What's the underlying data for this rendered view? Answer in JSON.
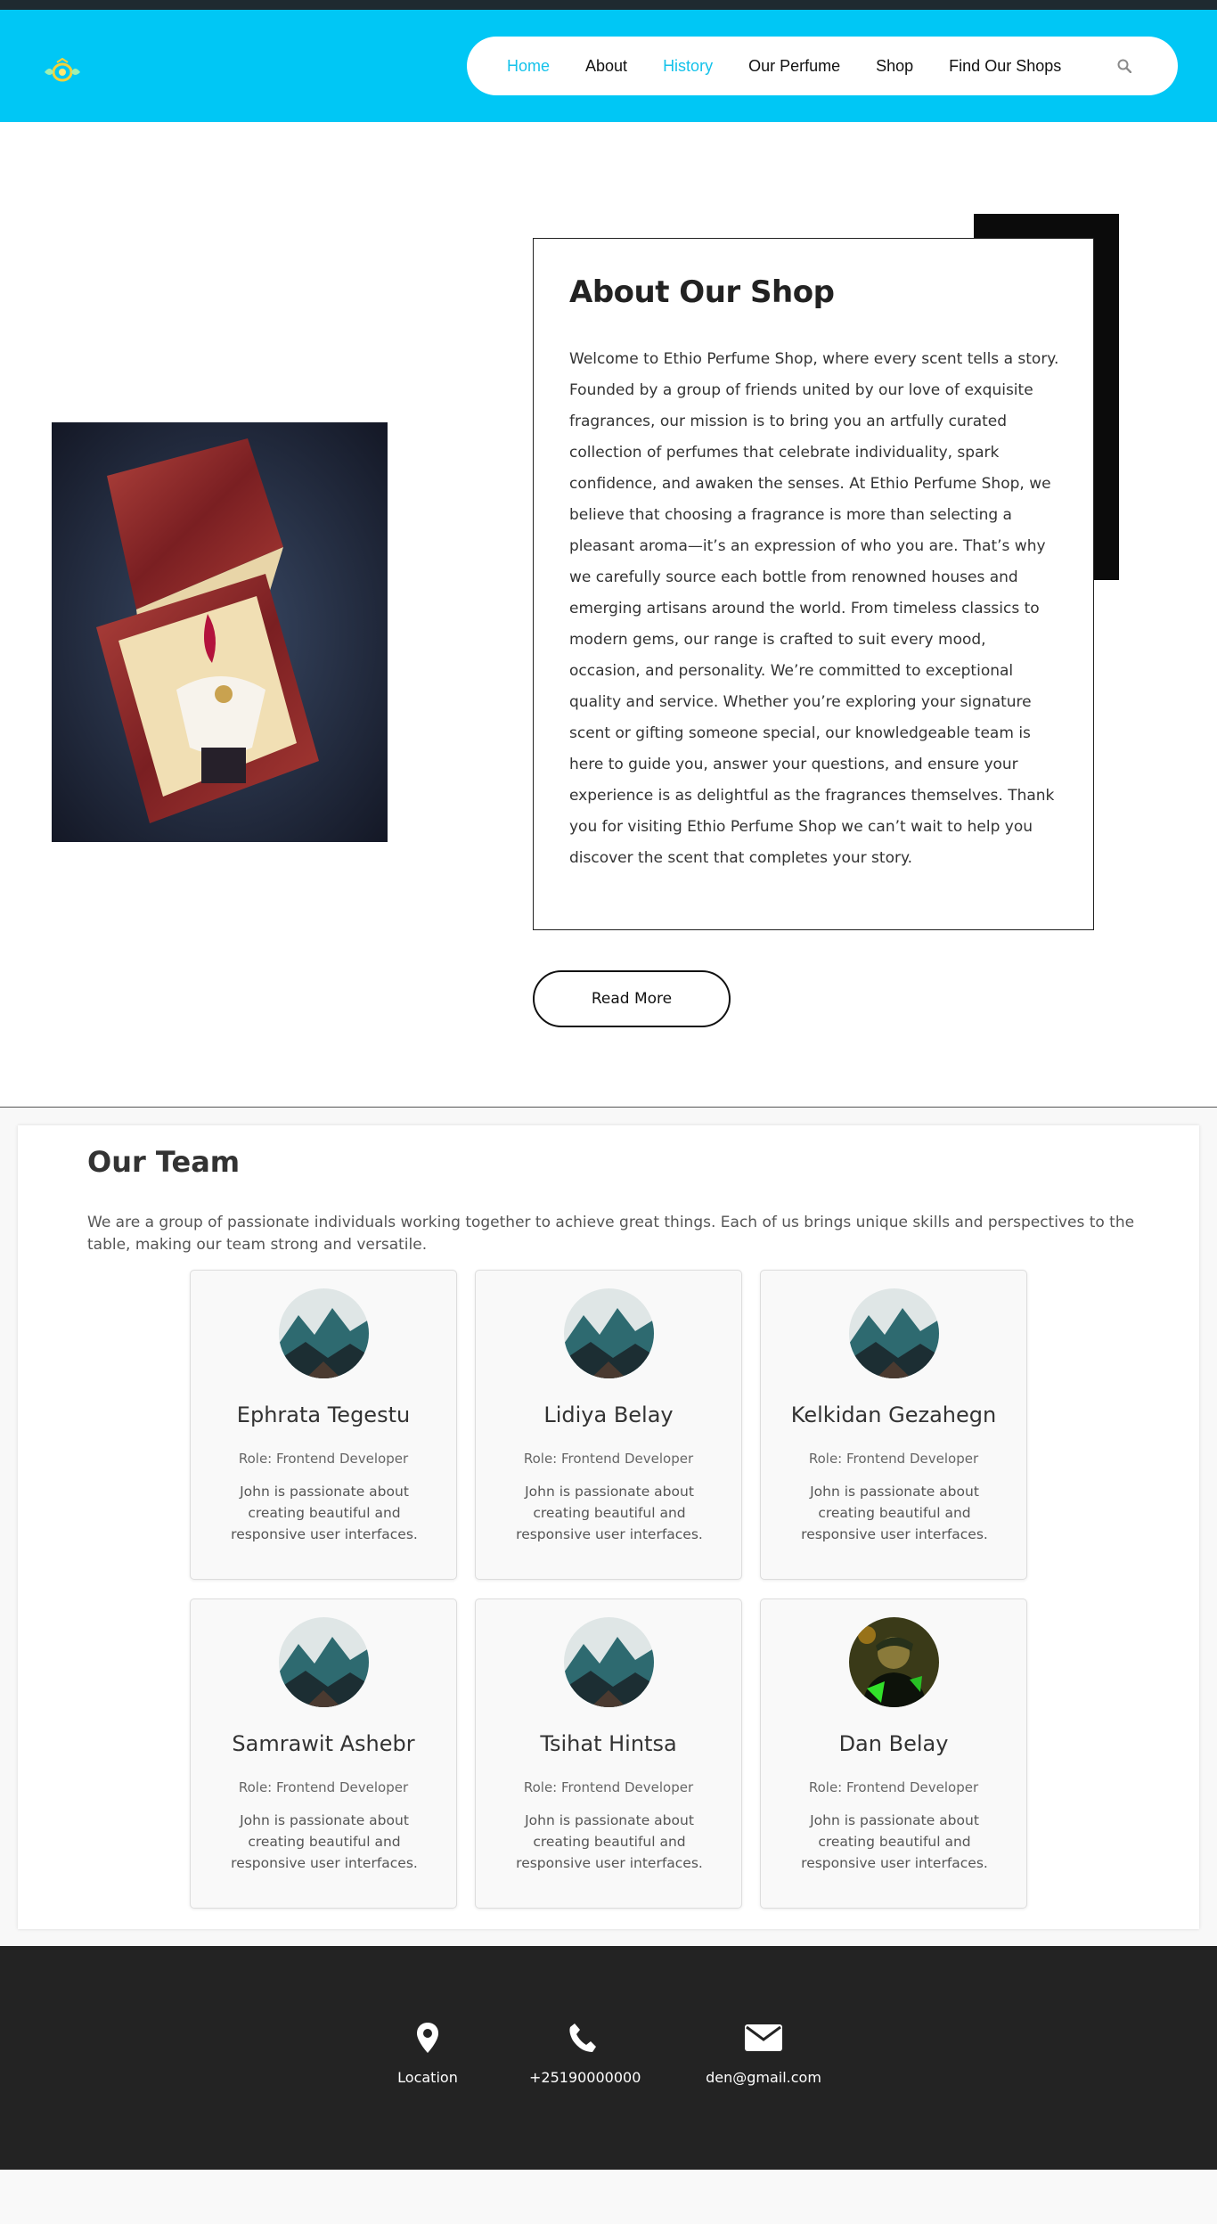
{
  "colors": {
    "header_bg": "#00c7f5",
    "nav_active": "#14c2ea",
    "footer_bg": "#232323"
  },
  "header": {
    "logo_icon": "perfume-logo-icon",
    "nav": {
      "home": "Home",
      "about": "About",
      "history": "History",
      "our_perfume": "Our Perfume",
      "shop": "Shop",
      "find_shops": "Find Our Shops"
    },
    "search_icon": "search-icon"
  },
  "about": {
    "title": "About Our Shop",
    "text": "Welcome to Ethio Perfume Shop, where every scent tells a story. Founded by a group of friends united by our love of exquisite fragrances, our mission is to bring you an artfully curated collection of perfumes that celebrate individuality, spark confidence, and awaken the senses. At Ethio Perfume Shop, we believe that choosing a fragrance is more than selecting a pleasant aroma—it’s an expression of who you are. That’s why we carefully source each bottle from renowned houses and emerging artisans around the world. From timeless classics to modern gems, our range is crafted to suit every mood, occasion, and personality. We’re committed to exceptional quality and service. Whether you’re exploring your signature scent or gifting someone special, our knowledgeable team is here to guide you, answer your questions, and ensure your experience is as delightful as the fragrances themselves. Thank you for visiting Ethio Perfume Shop we can’t wait to help you discover the scent that completes your story.",
    "read_more": "Read More"
  },
  "team": {
    "title": "Our Team",
    "intro": "We are a group of passionate individuals working together to achieve great things. Each of us brings unique skills and perspectives to the table, making our team strong and versatile.",
    "members": [
      {
        "name": "Ephrata Tegestu",
        "role": "Role: Frontend Developer",
        "desc": "John is passionate about creating beautiful and responsive user interfaces."
      },
      {
        "name": "Lidiya Belay",
        "role": "Role: Frontend Developer",
        "desc": "John is passionate about creating beautiful and responsive user interfaces."
      },
      {
        "name": "Kelkidan Gezahegn",
        "role": "Role: Frontend Developer",
        "desc": "John is passionate about creating beautiful and responsive user interfaces."
      },
      {
        "name": "Samrawit Ashebr",
        "role": "Role: Frontend Developer",
        "desc": "John is passionate about creating beautiful and responsive user interfaces."
      },
      {
        "name": "Tsihat Hintsa",
        "role": "Role: Frontend Developer",
        "desc": "John is passionate about creating beautiful and responsive user interfaces."
      },
      {
        "name": "Dan Belay",
        "role": "Role: Frontend Developer",
        "desc": "John is passionate about creating beautiful and responsive user interfaces."
      }
    ]
  },
  "footer": {
    "location": "Location",
    "phone": "+25190000000",
    "email": "den@gmail.com"
  }
}
